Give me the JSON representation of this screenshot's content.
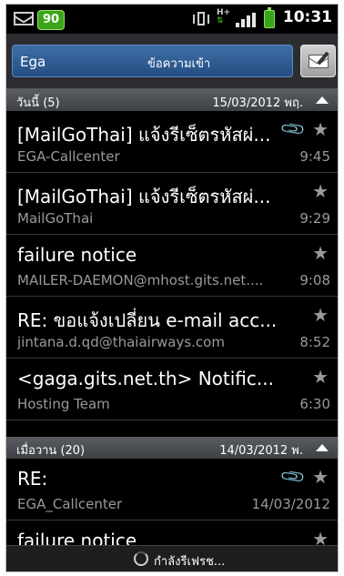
{
  "status_bar": {
    "notification_count": "90",
    "network": "H+",
    "time": "10:31",
    "colors": {
      "badge": "#3aa51a",
      "battery": "#3aa51a"
    }
  },
  "header": {
    "account": "Ega",
    "folder": "ข้อความเข้า"
  },
  "sections": [
    {
      "label": "วันนี้ (5)",
      "date": "15/03/2012 พฤ."
    },
    {
      "label": "เมื่อวาน (20)",
      "date": "14/03/2012 พ."
    }
  ],
  "messages": [
    {
      "subject": "[MailGoThai] แจ้งรีเซ็ตรหัสผ่...",
      "sender": "EGA-Callcenter",
      "time": "9:45",
      "attachment": true
    },
    {
      "subject": "[MailGoThai] แจ้งรีเซ็ตรหัสผ่...",
      "sender": "MailGoThai",
      "time": "9:29",
      "attachment": false
    },
    {
      "subject": "failure notice",
      "sender": "MAILER-DAEMON@mhost.gits.net....",
      "time": "9:08",
      "attachment": false
    },
    {
      "subject": "RE: ขอแจ้งเปลี่ยน e-mail acc...",
      "sender": "jintana.d.qd@thaiairways.com",
      "time": "8:52",
      "attachment": false
    },
    {
      "subject": "<gaga.gits.net.th> Notific...",
      "sender": "Hosting Team",
      "time": "6:30",
      "attachment": false
    },
    {
      "subject": "RE:",
      "sender": "EGA_Callcenter",
      "time": "14/03/2012",
      "attachment": true
    },
    {
      "subject": "failure notice",
      "sender": "",
      "time": "",
      "attachment": false
    }
  ],
  "footer": {
    "refresh_text": "กำลังรีเฟรช..."
  }
}
